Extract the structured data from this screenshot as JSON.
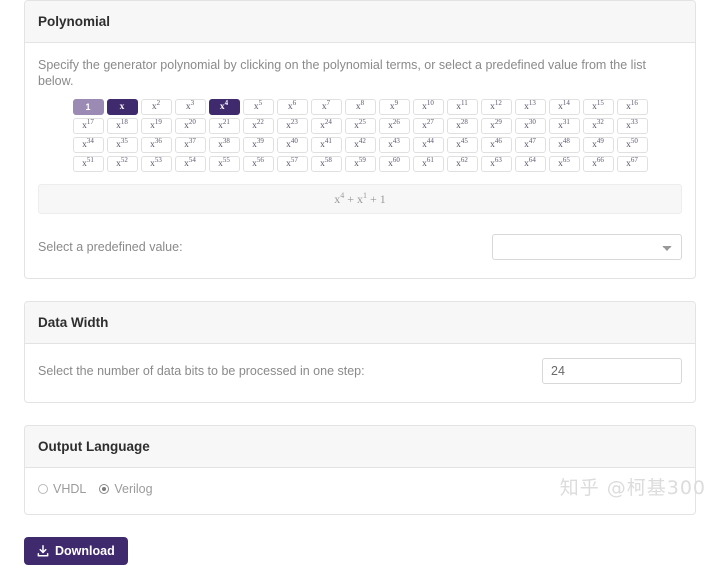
{
  "polynomial": {
    "title": "Polynomial",
    "description": "Specify the generator polynomial by clicking on the polynomial terms, or select a predefined value from the list below.",
    "terms": [
      {
        "label": "1",
        "exp": null,
        "state": "fixed"
      },
      {
        "label": "x",
        "exp": null,
        "state": "selected"
      },
      {
        "label": "x",
        "exp": "2",
        "state": "off"
      },
      {
        "label": "x",
        "exp": "3",
        "state": "off"
      },
      {
        "label": "x",
        "exp": "4",
        "state": "selected"
      },
      {
        "label": "x",
        "exp": "5",
        "state": "off"
      },
      {
        "label": "x",
        "exp": "6",
        "state": "off"
      },
      {
        "label": "x",
        "exp": "7",
        "state": "off"
      },
      {
        "label": "x",
        "exp": "8",
        "state": "off"
      },
      {
        "label": "x",
        "exp": "9",
        "state": "off"
      },
      {
        "label": "x",
        "exp": "10",
        "state": "off"
      },
      {
        "label": "x",
        "exp": "11",
        "state": "off"
      },
      {
        "label": "x",
        "exp": "12",
        "state": "off"
      },
      {
        "label": "x",
        "exp": "13",
        "state": "off"
      },
      {
        "label": "x",
        "exp": "14",
        "state": "off"
      },
      {
        "label": "x",
        "exp": "15",
        "state": "off"
      },
      {
        "label": "x",
        "exp": "16",
        "state": "off"
      },
      {
        "label": "x",
        "exp": "17",
        "state": "off"
      },
      {
        "label": "x",
        "exp": "18",
        "state": "off"
      },
      {
        "label": "x",
        "exp": "19",
        "state": "off"
      },
      {
        "label": "x",
        "exp": "20",
        "state": "off"
      },
      {
        "label": "x",
        "exp": "21",
        "state": "off"
      },
      {
        "label": "x",
        "exp": "22",
        "state": "off"
      },
      {
        "label": "x",
        "exp": "23",
        "state": "off"
      },
      {
        "label": "x",
        "exp": "24",
        "state": "off"
      },
      {
        "label": "x",
        "exp": "25",
        "state": "off"
      },
      {
        "label": "x",
        "exp": "26",
        "state": "off"
      },
      {
        "label": "x",
        "exp": "27",
        "state": "off"
      },
      {
        "label": "x",
        "exp": "28",
        "state": "off"
      },
      {
        "label": "x",
        "exp": "29",
        "state": "off"
      },
      {
        "label": "x",
        "exp": "30",
        "state": "off"
      },
      {
        "label": "x",
        "exp": "31",
        "state": "off"
      },
      {
        "label": "x",
        "exp": "32",
        "state": "off"
      },
      {
        "label": "x",
        "exp": "33",
        "state": "off"
      },
      {
        "label": "x",
        "exp": "34",
        "state": "off"
      },
      {
        "label": "x",
        "exp": "35",
        "state": "off"
      },
      {
        "label": "x",
        "exp": "36",
        "state": "off"
      },
      {
        "label": "x",
        "exp": "37",
        "state": "off"
      },
      {
        "label": "x",
        "exp": "38",
        "state": "off"
      },
      {
        "label": "x",
        "exp": "39",
        "state": "off"
      },
      {
        "label": "x",
        "exp": "40",
        "state": "off"
      },
      {
        "label": "x",
        "exp": "41",
        "state": "off"
      },
      {
        "label": "x",
        "exp": "42",
        "state": "off"
      },
      {
        "label": "x",
        "exp": "43",
        "state": "off"
      },
      {
        "label": "x",
        "exp": "44",
        "state": "off"
      },
      {
        "label": "x",
        "exp": "45",
        "state": "off"
      },
      {
        "label": "x",
        "exp": "46",
        "state": "off"
      },
      {
        "label": "x",
        "exp": "47",
        "state": "off"
      },
      {
        "label": "x",
        "exp": "48",
        "state": "off"
      },
      {
        "label": "x",
        "exp": "49",
        "state": "off"
      },
      {
        "label": "x",
        "exp": "50",
        "state": "off"
      },
      {
        "label": "x",
        "exp": "51",
        "state": "off"
      },
      {
        "label": "x",
        "exp": "52",
        "state": "off"
      },
      {
        "label": "x",
        "exp": "53",
        "state": "off"
      },
      {
        "label": "x",
        "exp": "54",
        "state": "off"
      },
      {
        "label": "x",
        "exp": "55",
        "state": "off"
      },
      {
        "label": "x",
        "exp": "56",
        "state": "off"
      },
      {
        "label": "x",
        "exp": "57",
        "state": "off"
      },
      {
        "label": "x",
        "exp": "58",
        "state": "off"
      },
      {
        "label": "x",
        "exp": "59",
        "state": "off"
      },
      {
        "label": "x",
        "exp": "60",
        "state": "off"
      },
      {
        "label": "x",
        "exp": "61",
        "state": "off"
      },
      {
        "label": "x",
        "exp": "62",
        "state": "off"
      },
      {
        "label": "x",
        "exp": "63",
        "state": "off"
      },
      {
        "label": "x",
        "exp": "64",
        "state": "off"
      },
      {
        "label": "x",
        "exp": "65",
        "state": "off"
      },
      {
        "label": "x",
        "exp": "66",
        "state": "off"
      },
      {
        "label": "x",
        "exp": "67",
        "state": "off"
      }
    ],
    "row_breaks": [
      17,
      17,
      17,
      17
    ],
    "display_parts": [
      {
        "label": "x",
        "exp": "4"
      },
      {
        "label": "x",
        "exp": "1"
      },
      {
        "label": "1",
        "exp": null
      }
    ],
    "display_separator": " + ",
    "predefined_label": "Select a predefined value:",
    "predefined_value": "",
    "predefined_options": [
      ""
    ]
  },
  "data_width": {
    "title": "Data Width",
    "label": "Select the number of data bits to be processed in one step:",
    "value": "24"
  },
  "output_language": {
    "title": "Output Language",
    "options": [
      {
        "label": "VHDL",
        "checked": false
      },
      {
        "label": "Verilog",
        "checked": true
      }
    ]
  },
  "actions": {
    "download_label": "Download"
  },
  "watermark": {
    "text": "知乎 @柯基300"
  },
  "colors": {
    "accent": "#3f2a6e",
    "fixed_term": "#9b8bb4",
    "header_bg": "#f7f7f7"
  }
}
